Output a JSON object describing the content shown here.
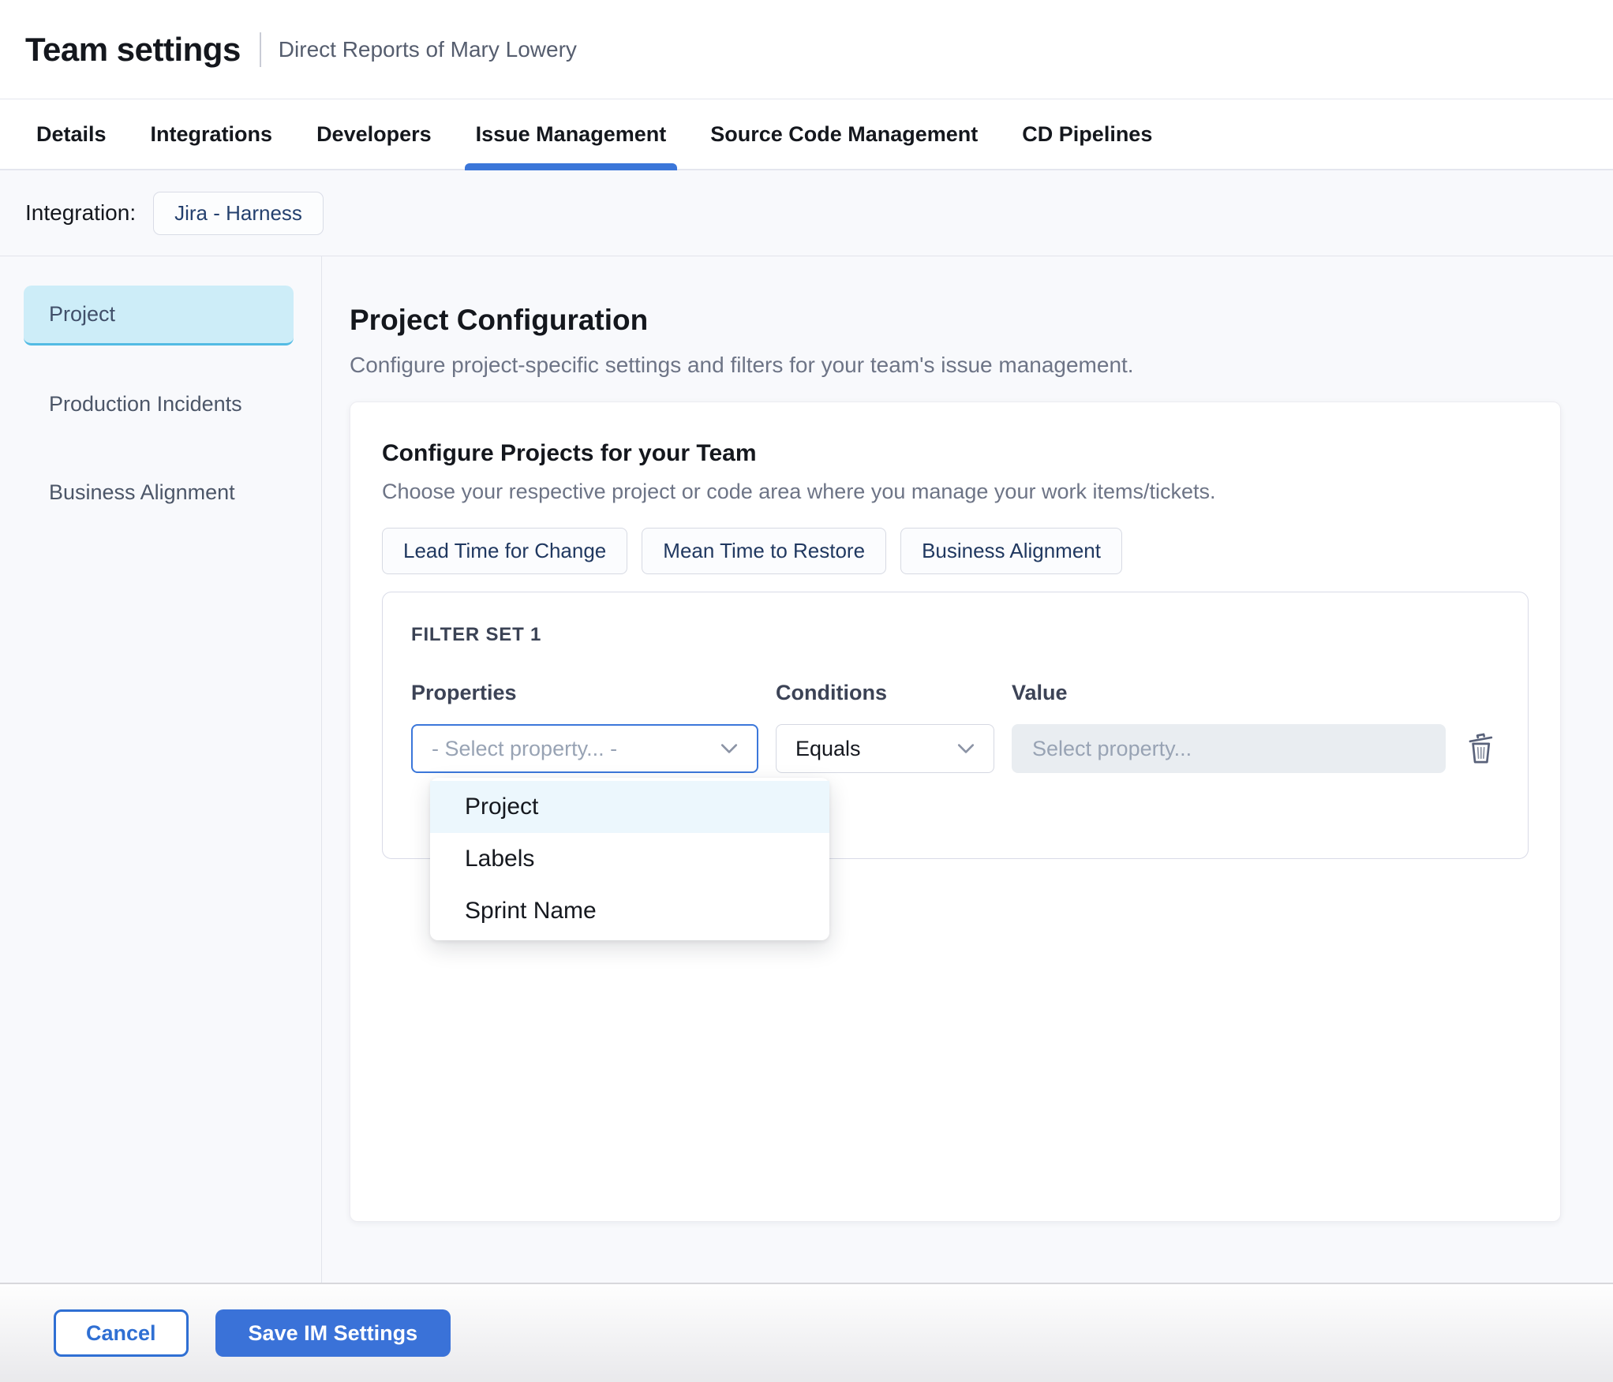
{
  "header": {
    "title": "Team settings",
    "subtitle": "Direct Reports of Mary Lowery"
  },
  "tabs": [
    {
      "label": "Details",
      "active": false
    },
    {
      "label": "Integrations",
      "active": false
    },
    {
      "label": "Developers",
      "active": false
    },
    {
      "label": "Issue Management",
      "active": true
    },
    {
      "label": "Source Code Management",
      "active": false
    },
    {
      "label": "CD Pipelines",
      "active": false
    }
  ],
  "integration": {
    "label": "Integration:",
    "value": "Jira - Harness"
  },
  "sidebar": {
    "items": [
      {
        "label": "Project",
        "selected": true
      },
      {
        "label": "Production Incidents",
        "selected": false
      },
      {
        "label": "Business Alignment",
        "selected": false
      }
    ]
  },
  "main": {
    "heading": "Project Configuration",
    "description": "Configure project-specific settings and filters for your team's issue management.",
    "card": {
      "title": "Configure Projects for your Team",
      "subtitle": "Choose your respective project or code area where you manage your work items/tickets.",
      "chips": [
        {
          "label": "Lead Time for Change"
        },
        {
          "label": "Mean Time to Restore"
        },
        {
          "label": "Business Alignment"
        }
      ],
      "filter_set": {
        "title": "FILTER SET 1",
        "columns": {
          "properties": "Properties",
          "conditions": "Conditions",
          "value": "Value"
        },
        "property_placeholder": "- Select property... -",
        "condition_value": "Equals",
        "value_placeholder": "Select property...",
        "options": [
          {
            "label": "Project",
            "highlighted": true
          },
          {
            "label": "Labels",
            "highlighted": false
          },
          {
            "label": "Sprint Name",
            "highlighted": false
          }
        ]
      }
    }
  },
  "footer": {
    "cancel_label": "Cancel",
    "save_label": "Save IM Settings"
  },
  "colors": {
    "accent_blue": "#3b76d9",
    "sidebar_selected_bg": "#cdedf8",
    "sidebar_selected_border": "#53bbe4",
    "option_highlight_bg": "#ecf7fd",
    "chip_text": "#203860",
    "save_button_bg": "#3a72d8",
    "disabled_input_bg": "#e9edf1",
    "page_bg": "#f8f9fc"
  }
}
